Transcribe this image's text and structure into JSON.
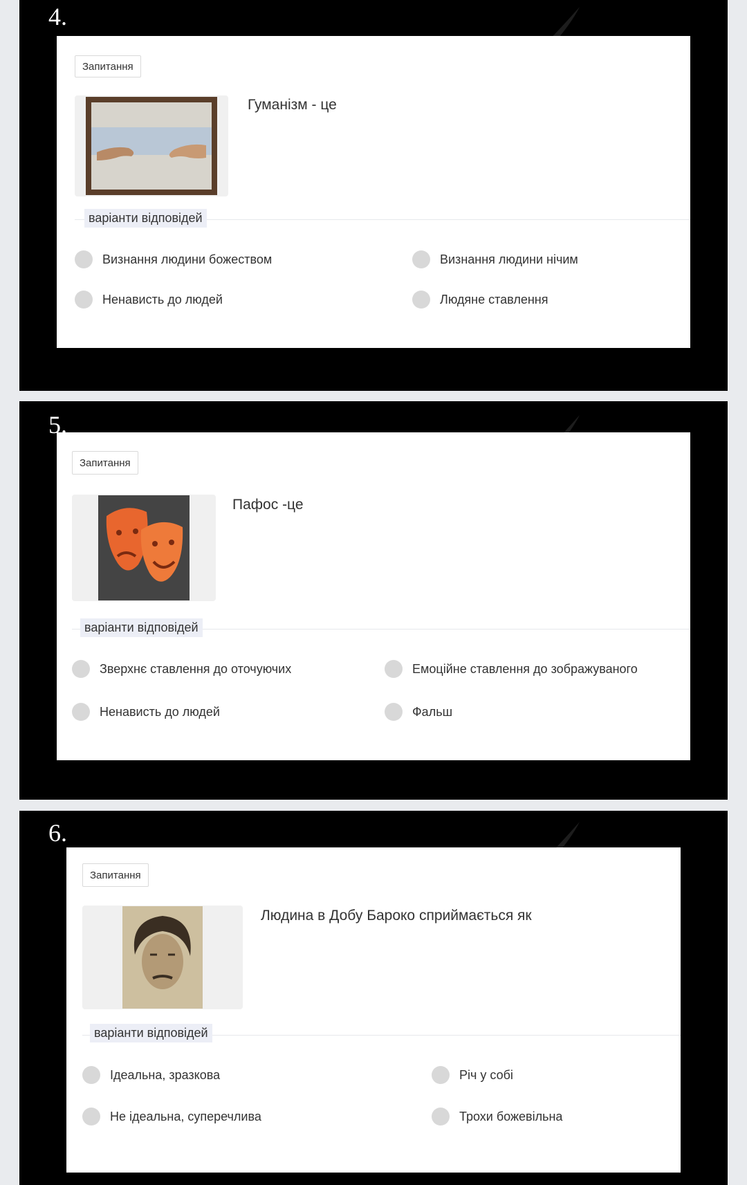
{
  "slides": [
    {
      "number": "4.",
      "tag": "Запитання",
      "question": "Гуманізм - це",
      "answers_label": "варіанти відповідей",
      "options": [
        "Визнання людини божеством",
        "Визнання людини нічим",
        "Ненависть до людей",
        "Людяне ставлення"
      ]
    },
    {
      "number": "5.",
      "tag": "Запитання",
      "question": "Пафос -це",
      "answers_label": "варіанти відповідей",
      "options": [
        "Зверхнє ставлення до оточуючих",
        "Емоційне ставлення до зображуваного",
        "Ненависть до людей",
        "Фальш"
      ]
    },
    {
      "number": "6.",
      "tag": "Запитання",
      "question": "Людина в Добу Бароко сприймається як",
      "answers_label": "варіанти відповідей",
      "options": [
        "Ідеальна, зразкова",
        "Річ у собі",
        "Не ідеальна, суперечлива",
        "Трохи божевільна"
      ]
    }
  ],
  "colors": {
    "slide_bg": "#000000",
    "card_bg": "#ffffff",
    "label_bg": "#eceef6",
    "radio": "#d8d8d8",
    "page_bg": "#e9ebee"
  },
  "icons": [
    "paintbrush-watermark-icon",
    "hands-painting-image",
    "theatre-masks-image",
    "portrait-drawing-image"
  ]
}
